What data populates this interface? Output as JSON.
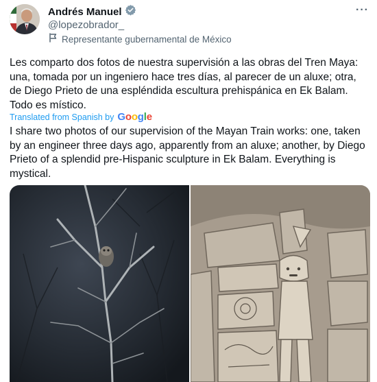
{
  "post": {
    "author_name": "Andrés Manuel",
    "verified_icon": "verified-badge-gray",
    "handle": "@lopezobrador_",
    "affiliation_icon": "government-flag-icon",
    "affiliation": "Representante gubernamental de México",
    "more_icon": "more-horizontal-icon",
    "more_label": "···",
    "text_original": "Les comparto dos fotos de nuestra supervisión a las obras del Tren Maya: una, tomada por un ingeniero hace tres días, al parecer de un aluxe; otra, de Diego Prieto de una espléndida escultura prehispánica en Ek Balam. Todo es místico.",
    "translated_label": "Translated from Spanish by",
    "translator_logo": "Google",
    "text_translated": "I share two photos of our supervision of the Mayan Train works: one, taken by an engineer three days ago, apparently from an aluxe; another, by Diego Prieto of a splendid pre-Hispanic sculpture in Ek Balam. Everything is mystical."
  },
  "colors": {
    "text": "#0f1419",
    "secondary": "#536471",
    "link": "#1d9bf0",
    "verified_badge": "#829aab"
  }
}
